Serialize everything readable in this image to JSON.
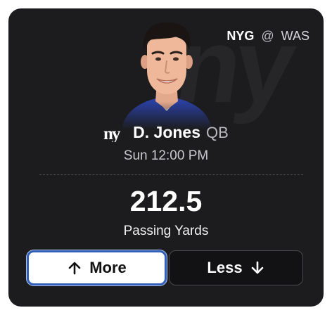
{
  "matchup": {
    "home_team": "NYG",
    "separator": "@",
    "away_team": "WAS"
  },
  "player": {
    "name": "D. Jones",
    "position": "QB",
    "team_logo_icon": "giants-ny-logo-icon"
  },
  "game": {
    "time": "Sun 12:00 PM"
  },
  "projection": {
    "value": "212.5",
    "stat": "Passing Yards"
  },
  "actions": {
    "more_label": "More",
    "less_label": "Less",
    "more_icon": "arrow-up-icon",
    "less_icon": "arrow-down-icon"
  },
  "colors": {
    "card_bg": "#1c1c1e",
    "selected_border": "#2f5fb8",
    "jersey_blue": "#2a3fa0"
  }
}
